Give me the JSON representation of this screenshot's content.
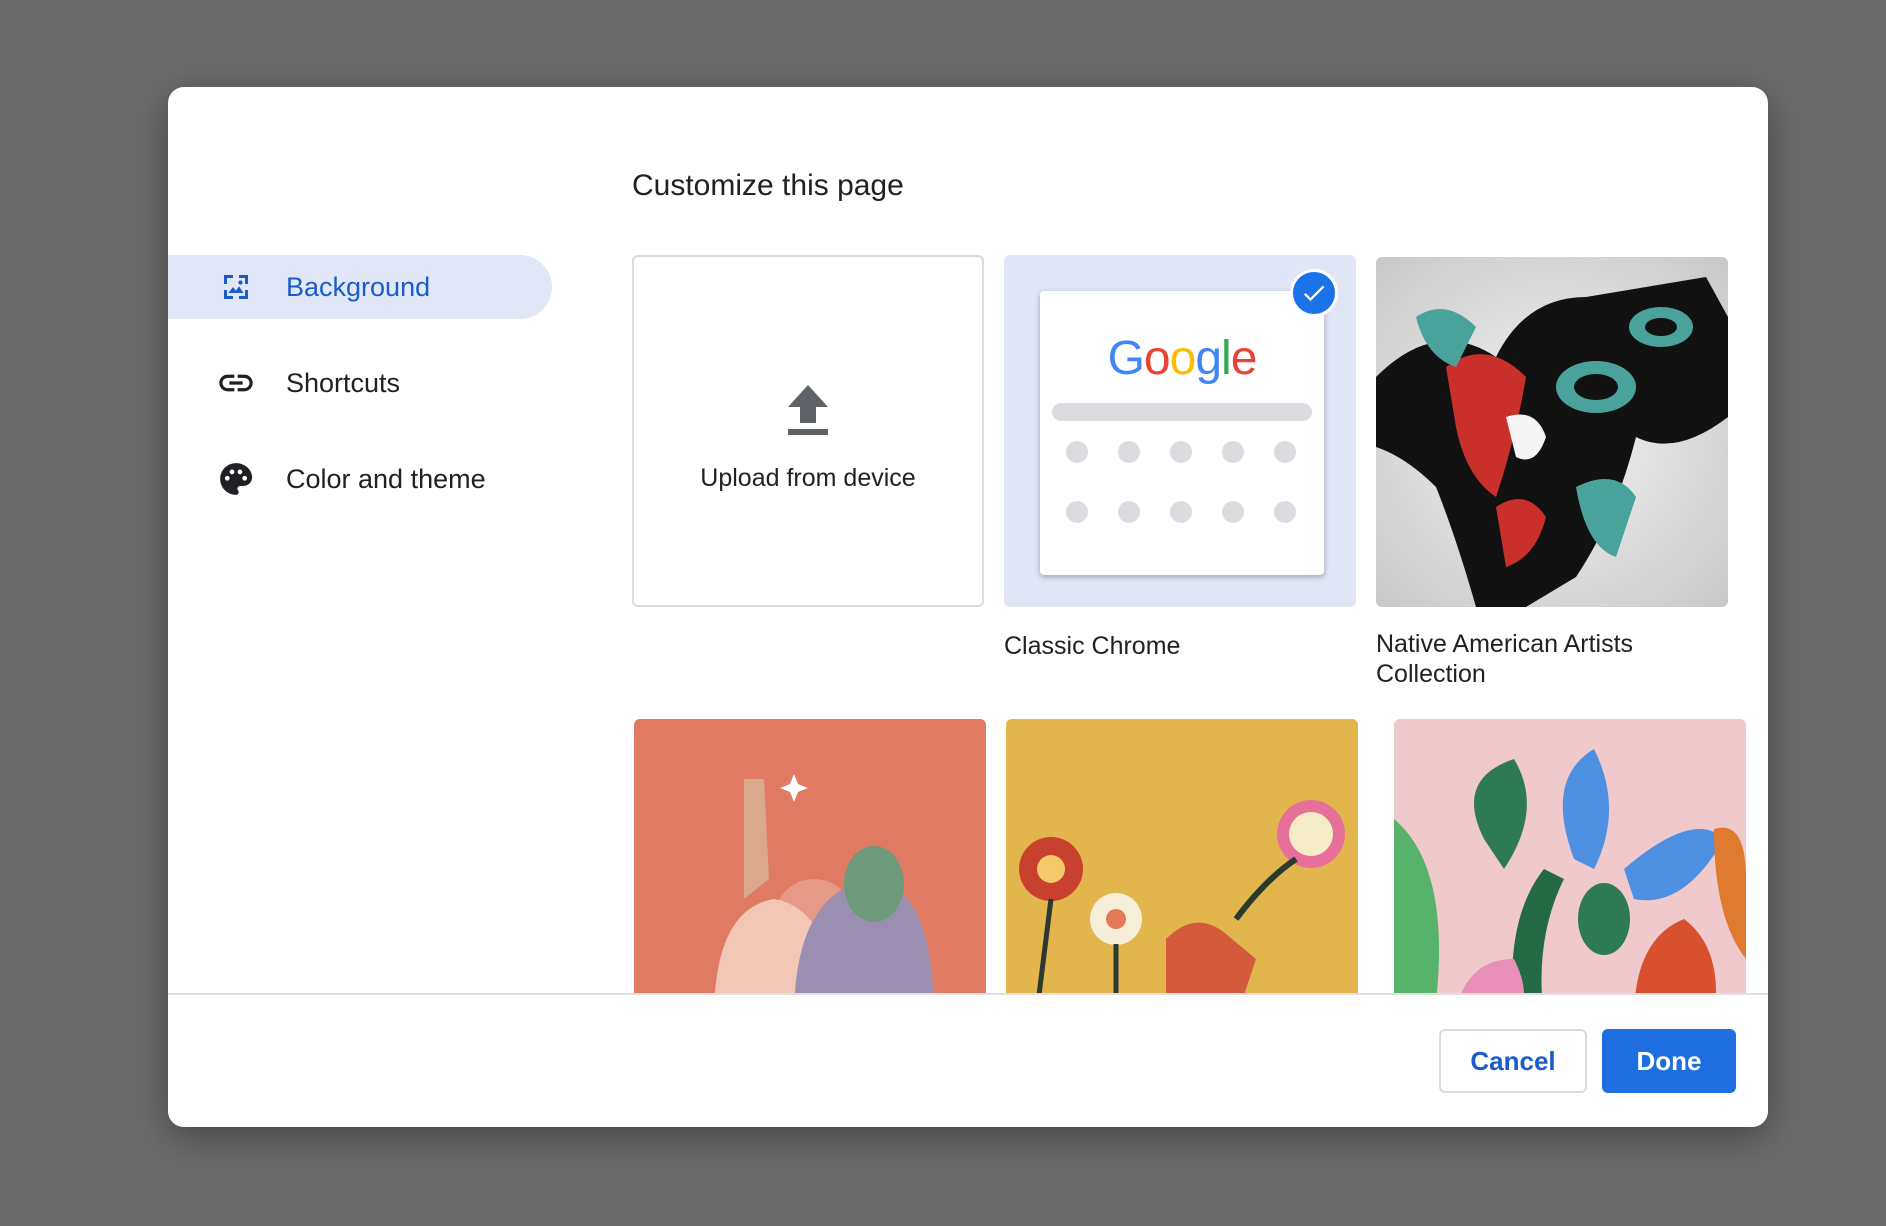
{
  "dialog": {
    "title": "Customize this page"
  },
  "nav": {
    "items": [
      {
        "label": "Background",
        "icon": "background-image-icon",
        "active": true
      },
      {
        "label": "Shortcuts",
        "icon": "link-icon",
        "active": false
      },
      {
        "label": "Color and theme",
        "icon": "palette-icon",
        "active": false
      }
    ]
  },
  "backgrounds": {
    "upload_label": "Upload from device",
    "classic_caption": "Classic Chrome",
    "classic_logo_text": "Google",
    "native_caption": "Native American Artists Collection"
  },
  "footer": {
    "cancel_label": "Cancel",
    "done_label": "Done"
  },
  "colors": {
    "accent": "#1a73e8",
    "selected_bg": "#e1e6f7",
    "overlay": "#6b6b6b"
  }
}
